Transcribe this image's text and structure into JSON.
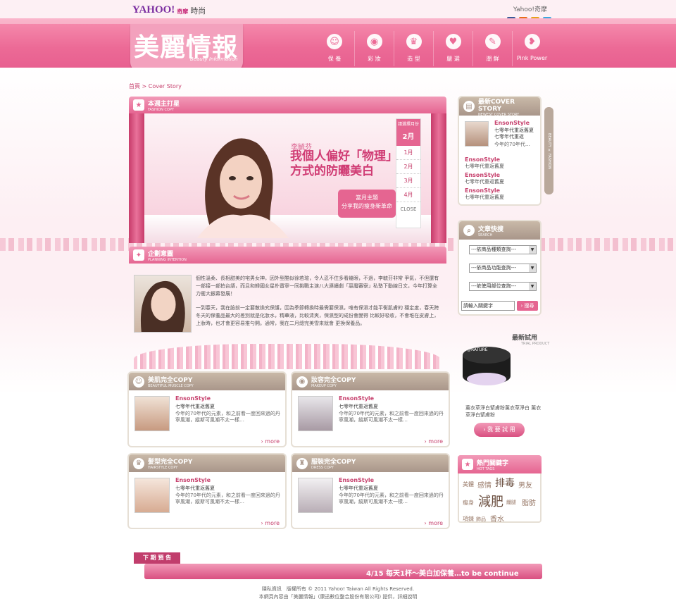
{
  "topbar": {
    "brand_yahoo": "YAHOO!",
    "brand_qimo": "奇摩",
    "brand_section": "時尚",
    "yahoo_link": "Yahoo!奇摩"
  },
  "social": [
    {
      "name": "facebook-icon",
      "color": "#3b5998"
    },
    {
      "name": "plurk-icon",
      "color": "#e86b1b"
    },
    {
      "name": "rss-icon",
      "color": "#e8a21b"
    },
    {
      "name": "twitter-icon",
      "color": "#3aa7e0"
    }
  ],
  "header": {
    "title": "美麗情報",
    "subtitle": "Beauty Information"
  },
  "nav": [
    {
      "label": "保 養",
      "icon": "☺",
      "name": "nav-skincare"
    },
    {
      "label": "彩 妝",
      "icon": "◉",
      "name": "nav-makeup"
    },
    {
      "label": "造 型",
      "icon": "♛",
      "name": "nav-style"
    },
    {
      "label": "嚴 選",
      "icon": "♥",
      "name": "nav-select"
    },
    {
      "label": "潮 鮮",
      "icon": "✎",
      "name": "nav-trend"
    },
    {
      "label": "Pink Power",
      "icon": "❥",
      "name": "nav-pink-power"
    }
  ],
  "breadcrumb": "首頁 > Cover Story",
  "feature": {
    "title": "本週主打星",
    "subtitle": "FASHION COPY",
    "name": "李毓芬",
    "headline": "我個人偏好「物理」方式的防曬美白",
    "badge_title": "當月主題",
    "badge_text": "分享我的瘦身新革命"
  },
  "months": {
    "header": "請選擇月份",
    "current": "2月",
    "items": [
      "1月",
      "2月",
      "3月",
      "4月"
    ],
    "close": "CLOSE"
  },
  "intent": {
    "title": "企劃意圖",
    "subtitle": "PLANNING INTENTION",
    "p1": "個性溫柔、長相甜美的宅男女神，因外型酷似徐若瑄，令人忍不住多看幾眼，不過，李毓芬非常 爭氣，不但還有一部接一部拍台語，而且和韓國女星朴寶寧一同挑戰主演八大連續劇「惡魔審寮」私塾下動線日文，今年打算全力衝大銀幕發展！",
    "p2": "一到春天，我在臉前一定要散換究保護，因為季節轉換時最需要保濕，唯有保濕才能平衡肌膚的 穩定度，春天跨冬天的保養品最大的差別就是化妝水，精華液，比較清爽，保濕型的成份會變得 比較好吸收，不會堆在皮膚上，上妝時，也才會更容易推勻開。通常，我在二月總完美雪來就會 更換保養品。"
  },
  "cards": [
    {
      "title": "美肌完全COPY",
      "subtitle": "BEAUTIFUL MUSCLE COPY",
      "icon": "☺",
      "name": "EnsonStyle",
      "sub": "七零年代重返舊夏",
      "desc": "今年的70年代的元素，和之前看一度回來過的丹寧風潮，縱斯可風潮不太一樣…",
      "more": "› more"
    },
    {
      "title": "妝容完全COPY",
      "subtitle": "MAKEUP COPY",
      "icon": "◉",
      "name": "EnsonStyle",
      "sub": "七零年代重返舊夏",
      "desc": "今年的70年代的元素，和之前看一度回來過的丹寧風潮，縱斯可風潮不太一樣…",
      "more": "› more"
    },
    {
      "title": "髮型完全COPY",
      "subtitle": "HAIRSTYLE COPY",
      "icon": "♛",
      "name": "EnsonStyle",
      "sub": "七零年代重返舊夏",
      "desc": "今年的70年代的元素，和之前看一度回來過的丹寧風潮，縱斯可風潮不太一樣…",
      "more": "› more"
    },
    {
      "title": "服裝完全COPY",
      "subtitle": "DRESS COPY",
      "icon": "♜",
      "name": "EnsonStyle",
      "sub": "七零年代重返舊夏",
      "desc": "今年的70年代的元素，和之前看一度回來過的丹寧風潮，縱斯可風潮不太一樣…",
      "more": "› more"
    }
  ],
  "cover_story": {
    "title": "最新COVER STORY",
    "subtitle": "NEWEST COVER STORY",
    "name": "EnsonStyle",
    "sub": "七零年代重返舊夏七零年代重返",
    "desc": "今年的70年代…",
    "items": [
      {
        "name": "EnsonStyle",
        "sub": "七零年代重返舊夏"
      },
      {
        "name": "EnsonStyle",
        "sub": "七零年代重返舊夏"
      },
      {
        "name": "EnsonStyle",
        "sub": "七零年代重返舊夏"
      }
    ],
    "vertical": "BEAUTY × FASHION"
  },
  "search": {
    "title": "文章快搜",
    "subtitle": "SEARCH",
    "selects": [
      "---依商品種類查詢---",
      "---依商品功能查詢---",
      "---依使用部位查詢---"
    ],
    "placeholder": "請輸入關鍵字",
    "button": "› 搜尋"
  },
  "trial": {
    "title": "最新試用",
    "subtitle": "TRIAL PRODUCT",
    "brand": "@RATURE",
    "desc": "薰衣草淨白緊膚粉薰衣草淨白 薰衣草淨白緊膚粉",
    "button": "› 我 要 試 用"
  },
  "tags": {
    "title": "熱門關鍵字",
    "subtitle": "HOT TAGS",
    "items": [
      "美體",
      "感情",
      "排毒",
      "男友",
      "瘦身",
      "減肥",
      "纖腿",
      "脂肪",
      "項鍊",
      "飾品",
      "香水"
    ]
  },
  "next": {
    "label": "下 期 預 告",
    "text": "4/15 每天1杯～美白加保養…to be continue"
  },
  "footer": {
    "line1": "隱私資訊　版權所有 © 2011 Yahoo! Taiwan All Rights Reserved.",
    "line2": "本網頁內容由「美麗情報」(康迅數位整合股份有限公司) 提供，詳細說明"
  }
}
